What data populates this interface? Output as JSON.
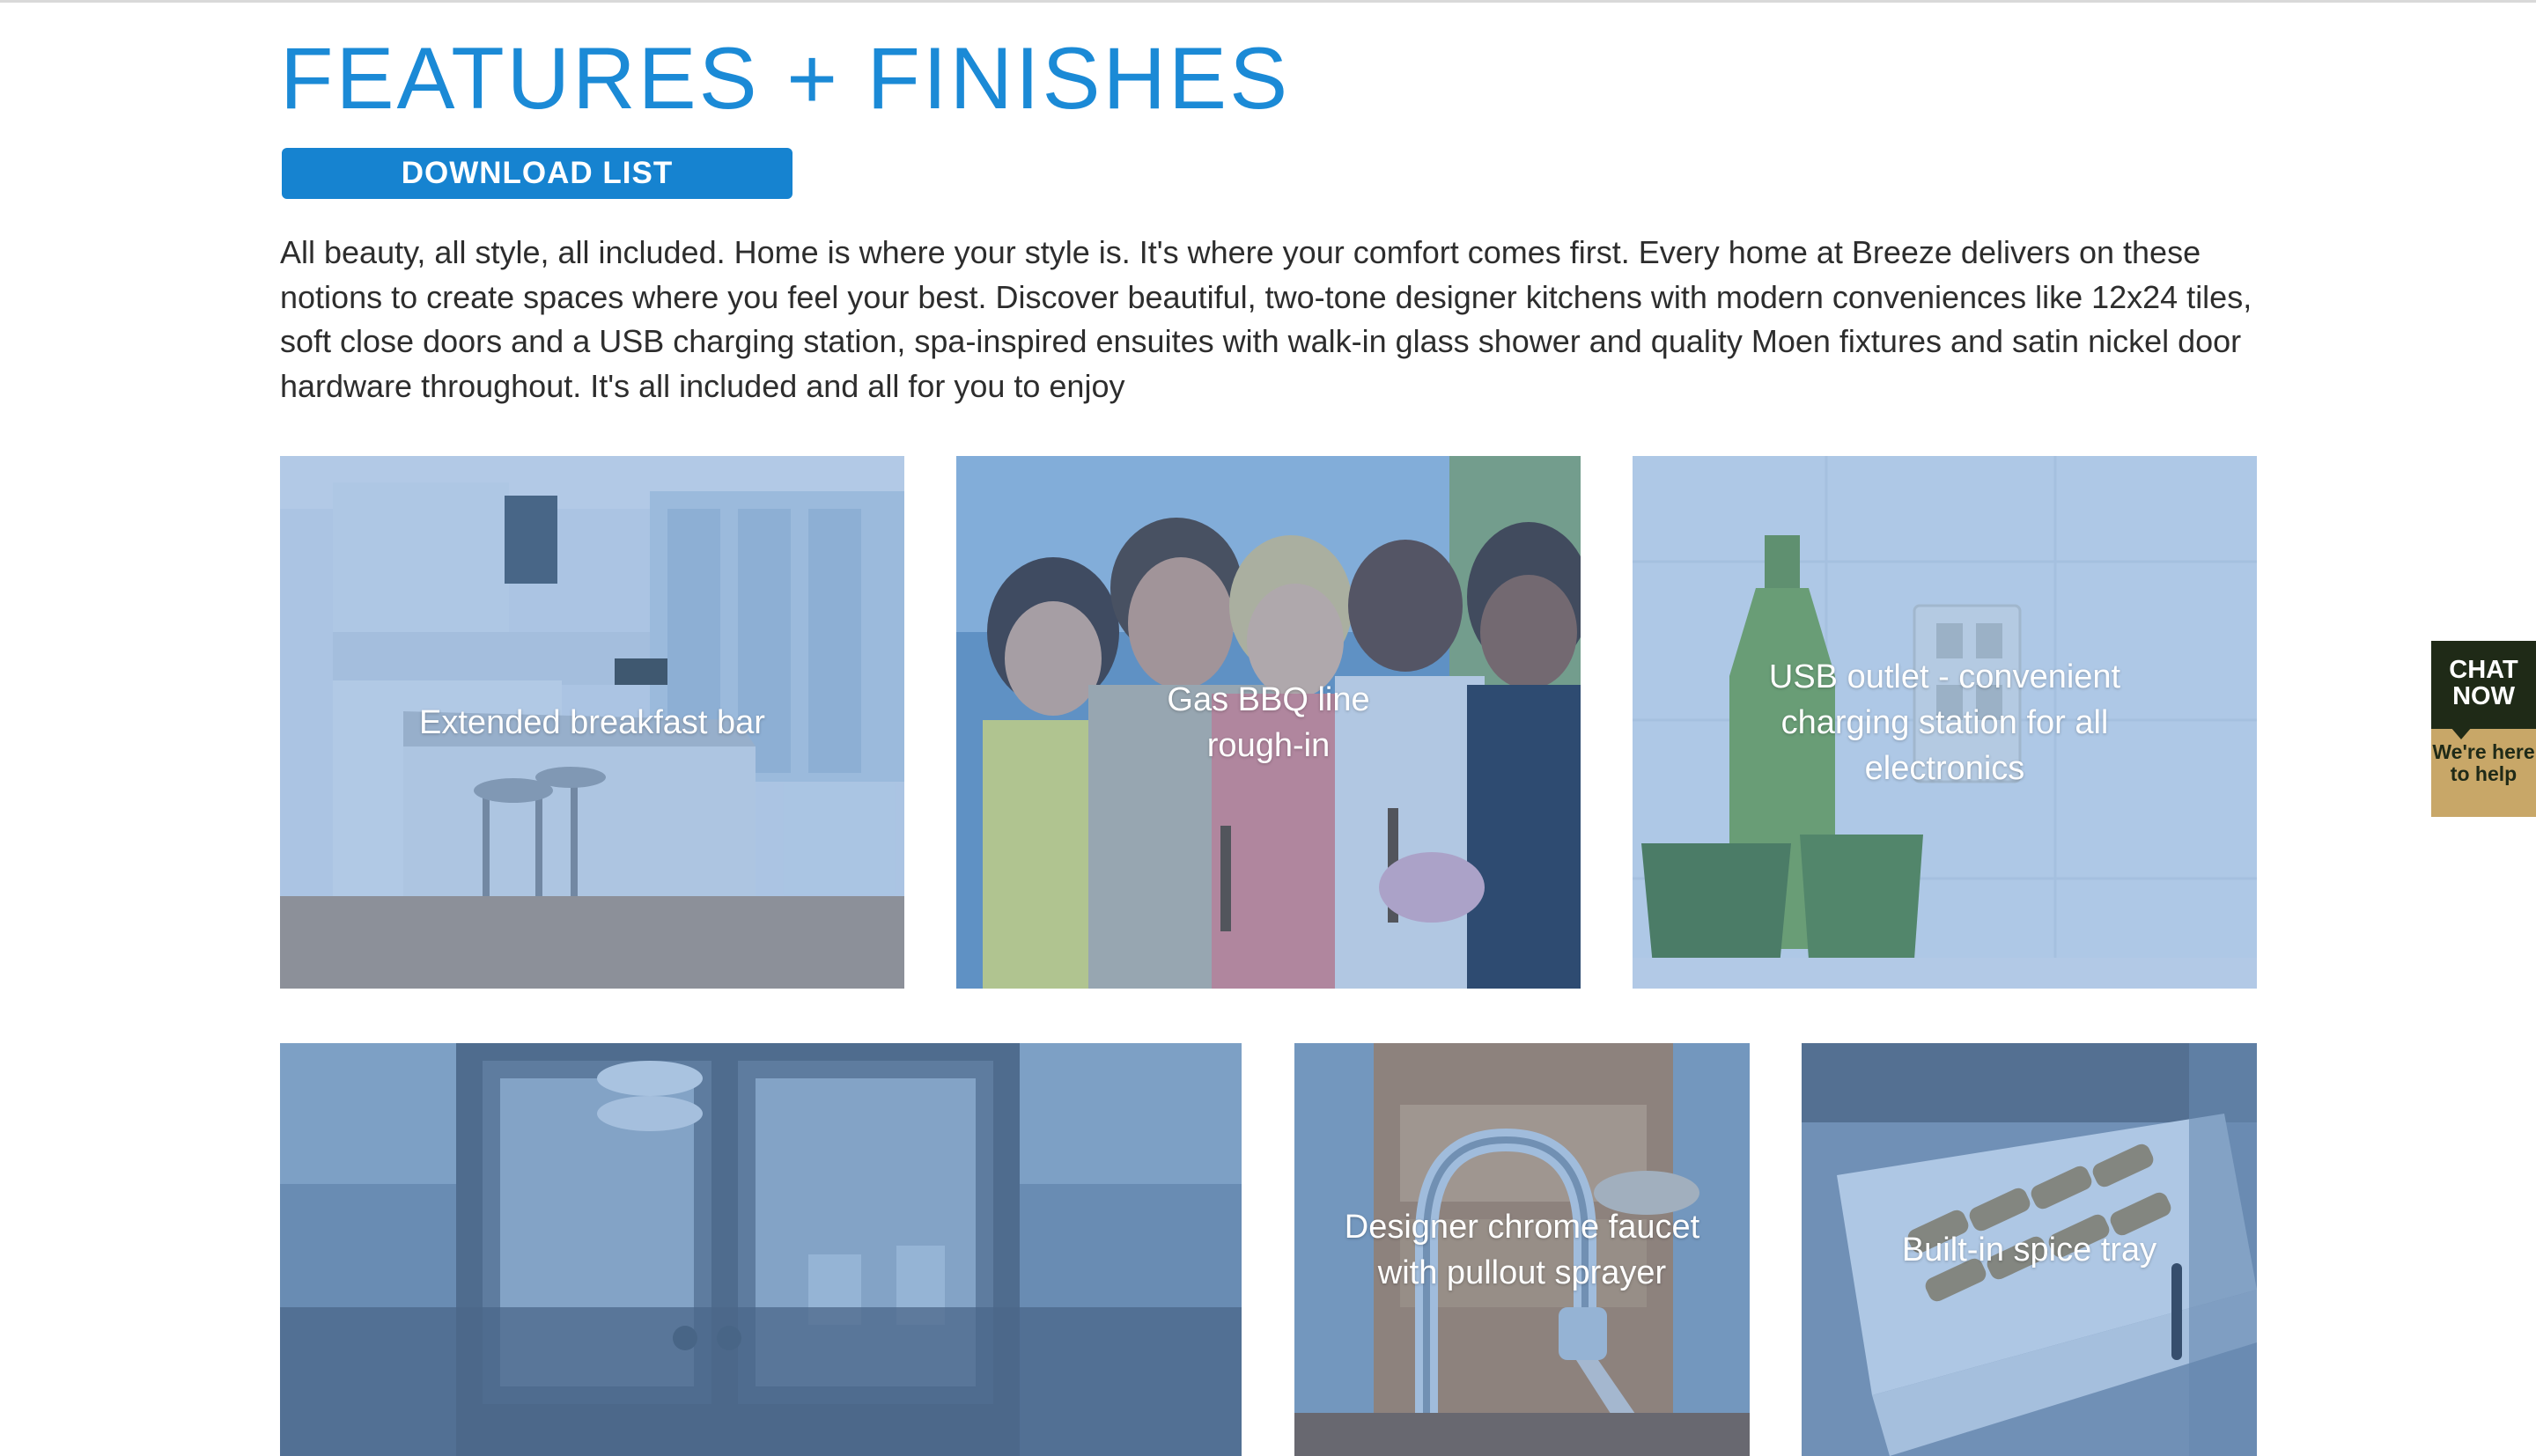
{
  "page": {
    "title": "FEATURES + FINISHES",
    "download_label": "DOWNLOAD LIST",
    "intro": "All beauty, all style, all included. Home is where your style is. It's where your comfort comes first. Every home at Breeze delivers on these notions to create spaces where you feel your best. Discover beautiful, two-tone designer kitchens with modern conveniences like 12x24 tiles, soft close doors and a USB charging station, spa-inspired ensuites with walk-in glass shower and quality Moen fixtures and satin nickel door hardware throughout. It's all included and all for you to enjoy"
  },
  "features": [
    {
      "caption": "Extended breakfast bar"
    },
    {
      "caption": "Gas BBQ line rough-in"
    },
    {
      "caption": "USB outlet - convenient charging station for all electronics"
    },
    {
      "caption": ""
    },
    {
      "caption": "Designer chrome faucet with pullout sprayer"
    },
    {
      "caption": "Built-in spice tray"
    }
  ],
  "chat": {
    "label": "CHAT NOW",
    "sublabel": "We're here to help"
  },
  "colors": {
    "accent": "#1b8ad6",
    "button": "#1683d0",
    "tile_overlay": "#4682c8",
    "chat_dark": "#1f2a17",
    "chat_gold": "#c8a768"
  }
}
